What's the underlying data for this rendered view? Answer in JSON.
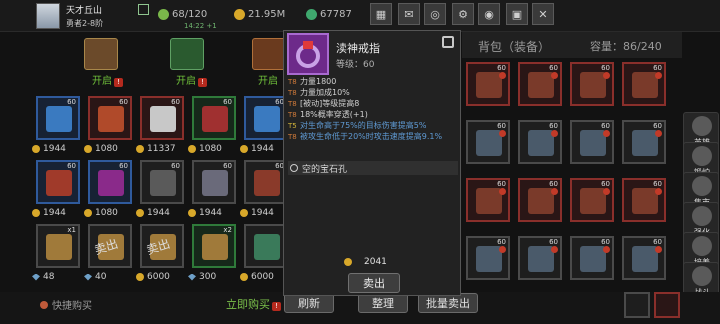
{
  "player": {
    "name": "天才丘山",
    "title": "勇者2-8阶"
  },
  "stats": {
    "stamina": "68/120",
    "stamina_timer": "14:22 +1",
    "gold": "21.95M",
    "gems": "67787"
  },
  "top_buttons": [
    {
      "icon": "shop-icon"
    },
    {
      "icon": "mail-icon"
    },
    {
      "icon": "gamepad-icon"
    },
    {
      "icon": "gear-icon"
    },
    {
      "icon": "color-wheel-icon"
    },
    {
      "icon": "gift-icon"
    },
    {
      "icon": "crossed-swords-icon"
    }
  ],
  "chests": {
    "label": "开启"
  },
  "shop_slots": [
    {
      "rarity": "blue",
      "level": "60",
      "art": "staff",
      "price": "1944",
      "currency": "coin"
    },
    {
      "rarity": "red",
      "level": "60",
      "art": "book",
      "price": "1080",
      "currency": "coin"
    },
    {
      "rarity": "red",
      "level": "60",
      "art": "polearm",
      "price": "11337",
      "currency": "coin"
    },
    {
      "rarity": "green",
      "level": "60",
      "art": "bow",
      "price": "1080",
      "currency": "coin"
    },
    {
      "rarity": "blue",
      "level": "60",
      "art": "staff",
      "price": "1944",
      "currency": "coin"
    },
    {
      "rarity": "blue",
      "level": "60",
      "art": "helmet",
      "price": "1944",
      "currency": "coin"
    },
    {
      "rarity": "blue",
      "level": "60",
      "art": "armor",
      "price": "1080",
      "currency": "coin"
    },
    {
      "rarity": "gray",
      "level": "60",
      "art": "gloves",
      "price": "1944",
      "currency": "coin"
    },
    {
      "rarity": "gray",
      "level": "60",
      "art": "legs",
      "price": "1944",
      "currency": "coin"
    },
    {
      "rarity": "gray",
      "level": "60",
      "art": "boots",
      "price": "1944",
      "currency": "coin"
    },
    {
      "rarity": "gray",
      "level": "",
      "art": "tome",
      "price": "48",
      "currency": "gem",
      "count": "x1",
      "sold": ""
    },
    {
      "rarity": "gray",
      "level": "",
      "art": "tome",
      "price": "40",
      "currency": "gem",
      "count": "",
      "sold": "卖出"
    },
    {
      "rarity": "gray",
      "level": "",
      "art": "tome",
      "price": "6000",
      "currency": "coin",
      "count": "",
      "sold": "卖出"
    },
    {
      "rarity": "green",
      "level": "",
      "art": "tome",
      "price": "300",
      "currency": "gem",
      "count": "x2",
      "sold": ""
    },
    {
      "rarity": "gray",
      "level": "",
      "art": "chest",
      "price": "6000",
      "currency": "coin",
      "count": "",
      "sold": ""
    }
  ],
  "bag": {
    "title": "背包（装备）",
    "capacity": "容量：86/240",
    "items": [
      {
        "rarity": "red",
        "level": "60"
      },
      {
        "rarity": "red",
        "level": "60"
      },
      {
        "rarity": "red",
        "level": "60"
      },
      {
        "rarity": "red",
        "level": "60"
      },
      {
        "rarity": "gray",
        "level": "60"
      },
      {
        "rarity": "gray",
        "level": "60"
      },
      {
        "rarity": "gray",
        "level": "60"
      },
      {
        "rarity": "gray",
        "level": "60"
      },
      {
        "rarity": "red",
        "level": "60"
      },
      {
        "rarity": "red",
        "level": "60"
      },
      {
        "rarity": "red",
        "level": "60"
      },
      {
        "rarity": "red",
        "level": "60"
      },
      {
        "rarity": "gray",
        "level": "60"
      },
      {
        "rarity": "gray",
        "level": "60"
      },
      {
        "rarity": "gray",
        "level": "60"
      },
      {
        "rarity": "gray",
        "level": "60"
      }
    ]
  },
  "side_menu": [
    {
      "label": "英雄",
      "icon": "hero-icon"
    },
    {
      "label": "锻炉",
      "icon": "forge-icon"
    },
    {
      "label": "集市",
      "icon": "market-icon"
    },
    {
      "label": "强化",
      "icon": "enhance-icon"
    },
    {
      "label": "培养",
      "icon": "train-icon"
    },
    {
      "label": "战斗",
      "icon": "battle-icon"
    }
  ],
  "item_popup": {
    "name": "渎神戒指",
    "level": "等级：60",
    "stats": [
      {
        "tier": "T8",
        "text": "力量1800",
        "style": "normal"
      },
      {
        "tier": "T8",
        "text": "力量加成10%",
        "style": "normal"
      },
      {
        "tier": "T8",
        "text": "[被动]等级提高8",
        "style": "normal"
      },
      {
        "tier": "T8",
        "text": "18%概率穿透(+1)",
        "style": "normal"
      },
      {
        "tier": "T5",
        "text": "对生命高于75%的目标伤害提高5%",
        "style": "blue"
      },
      {
        "tier": "T8",
        "text": "被攻生命低于20%时攻击速度提高9.1%",
        "style": "blue"
      }
    ],
    "socket": "空的宝石孔",
    "price": "2041",
    "sell_label": "卖出"
  },
  "bottom": {
    "quick_buy": "快捷购买",
    "buy_now": "立即购买",
    "refresh": "刷新",
    "sort": "整理",
    "bulk_sell": "批量卖出"
  }
}
